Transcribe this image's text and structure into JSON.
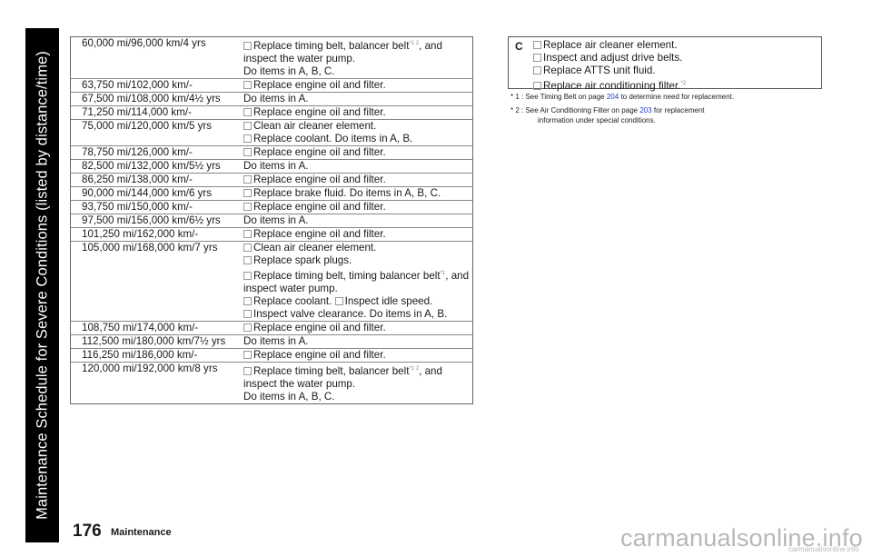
{
  "sidebar": {
    "title": "Maintenance Schedule for Severe Conditions (listed by distance/time)"
  },
  "schedule": [
    {
      "interval": "60,000 mi/96,000 km/4 yrs",
      "lines": [
        {
          "check": true,
          "text": "Replace timing belt, balancer belt",
          "sup": "*1 2",
          "tail": ", and"
        },
        {
          "check": false,
          "text": "inspect the water pump."
        },
        {
          "check": false,
          "text": "Do items in A, B, C."
        }
      ]
    },
    {
      "interval": "63,750 mi/102,000 km/-",
      "lines": [
        {
          "check": true,
          "text": "Replace engine oil and filter."
        }
      ]
    },
    {
      "interval": "67,500 mi/108,000 km/4½ yrs",
      "lines": [
        {
          "check": false,
          "text": "Do items in A."
        }
      ]
    },
    {
      "interval": "71,250 mi/114,000 km/-",
      "lines": [
        {
          "check": true,
          "text": "Replace engine oil and filter."
        }
      ]
    },
    {
      "interval": "75,000 mi/120,000 km/5 yrs",
      "lines": [
        {
          "check": true,
          "text": "Clean air cleaner element."
        },
        {
          "check": true,
          "text": "Replace coolant. Do items in A, B."
        }
      ]
    },
    {
      "interval": "78,750 mi/126,000 km/-",
      "lines": [
        {
          "check": true,
          "text": "Replace engine oil and filter."
        }
      ]
    },
    {
      "interval": "82,500 mi/132,000 km/5½ yrs",
      "lines": [
        {
          "check": false,
          "text": "Do items in A."
        }
      ]
    },
    {
      "interval": "86,250 mi/138,000 km/-",
      "lines": [
        {
          "check": true,
          "text": "Replace engine oil and filter."
        }
      ]
    },
    {
      "interval": "90,000 mi/144,000 km/6 yrs",
      "lines": [
        {
          "check": true,
          "text": "Replace brake fluid. Do items in A, B, C."
        }
      ]
    },
    {
      "interval": "93,750 mi/150,000 km/-",
      "lines": [
        {
          "check": true,
          "text": "Replace engine oil and filter."
        }
      ]
    },
    {
      "interval": "97,500 mi/156,000 km/6½ yrs",
      "lines": [
        {
          "check": false,
          "text": "Do items in A."
        }
      ]
    },
    {
      "interval": "101,250 mi/162,000 km/-",
      "lines": [
        {
          "check": true,
          "text": "Replace engine oil and filter."
        }
      ]
    },
    {
      "interval": "105,000 mi/168,000 km/7 yrs",
      "lines": [
        {
          "check": true,
          "text": "Clean air cleaner element."
        },
        {
          "check": true,
          "text": "Replace spark plugs."
        },
        {
          "check": true,
          "text": "Replace timing belt, timing balancer belt",
          "sup": "*1",
          "tail": ", and"
        },
        {
          "check": false,
          "text": "inspect water pump."
        },
        {
          "check": true,
          "text": "Replace coolant.",
          "check2": true,
          "text2": "Inspect idle speed."
        },
        {
          "check": true,
          "text": "Inspect valve clearance. Do items in A, B."
        }
      ]
    },
    {
      "interval": "108,750 mi/174,000 km/-",
      "lines": [
        {
          "check": true,
          "text": "Replace engine oil and filter."
        }
      ]
    },
    {
      "interval": "112,500 mi/180,000 km/7½ yrs",
      "lines": [
        {
          "check": false,
          "text": "Do items in A."
        }
      ]
    },
    {
      "interval": "116,250 mi/186,000 km/-",
      "lines": [
        {
          "check": true,
          "text": "Replace engine oil and filter."
        }
      ]
    },
    {
      "interval": "120,000 mi/192,000 km/8 yrs",
      "lines": [
        {
          "check": true,
          "text": "Replace timing belt, balancer belt",
          "sup": "*1 2",
          "tail": ", and"
        },
        {
          "check": false,
          "text": "inspect the water pump."
        },
        {
          "check": false,
          "text": "Do items in A, B, C."
        }
      ]
    }
  ],
  "group_c": {
    "letter": "C",
    "items": [
      {
        "text": "Replace air cleaner element."
      },
      {
        "text": "Inspect and adjust drive belts."
      },
      {
        "text": "Replace ATTS unit fluid."
      },
      {
        "text": "Replace air conditioning filter.",
        "sup": "*2"
      }
    ]
  },
  "footnotes": [
    {
      "mark": "* 1",
      "pre": " : See Timing Belt on page ",
      "page": "204",
      "post": " to determine need for replacement."
    },
    {
      "mark": "* 2",
      "pre": " : See Air Conditioning  Filter on page ",
      "page": "203",
      "post": " for replacement",
      "cont": "information  under special  conditions."
    }
  ],
  "footer": {
    "page_number": "176",
    "section": "Maintenance"
  },
  "watermark": {
    "large": "carmanualsonline.info",
    "small": "carmanualsonline.info"
  },
  "colors": {
    "link": "#2040d0",
    "sidebar": "#000000"
  }
}
